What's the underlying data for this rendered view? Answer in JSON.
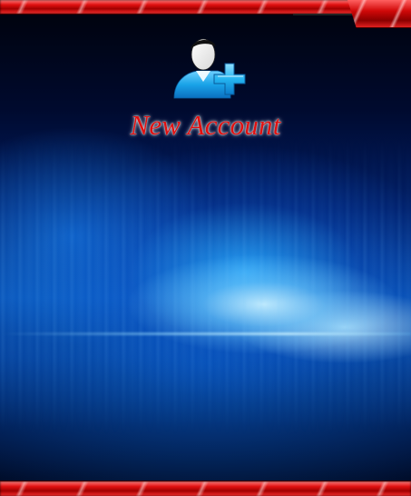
{
  "window": {
    "title": "New Account",
    "icon": "add-user-icon"
  },
  "colors": {
    "border_red": "#e01010",
    "title_red": "#e01010",
    "background_blue": "#0a4fb0",
    "icon_blue": "#1aa3e8"
  }
}
